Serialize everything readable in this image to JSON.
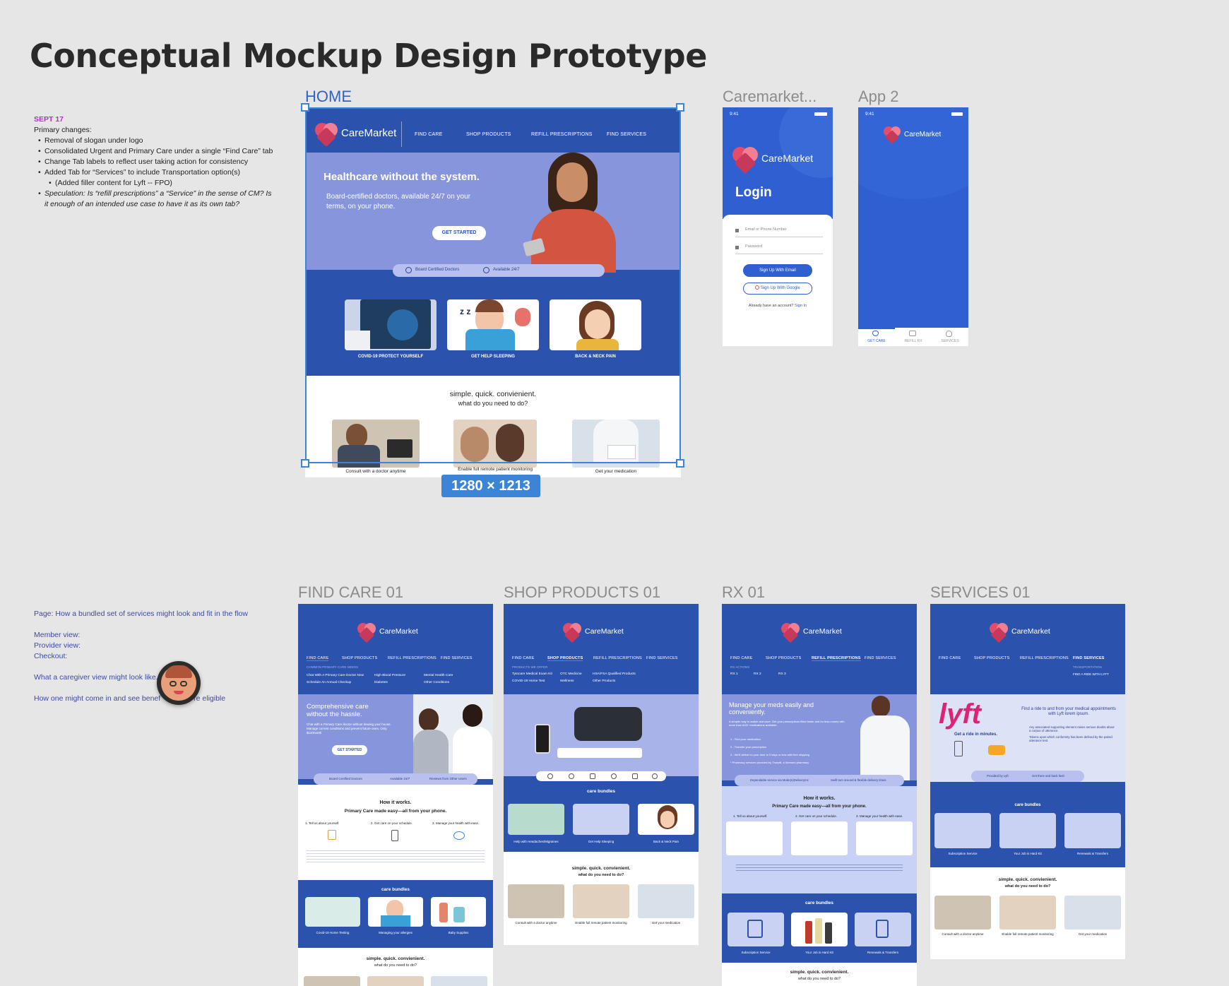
{
  "title": "Conceptual Mockup Design Prototype",
  "notes": {
    "date": "SEPT 17",
    "heading": "Primary changes:",
    "items": [
      "Removal of slogan under logo",
      "Consolidated Urgent and Primary Care under a single “Find Care” tab",
      "Change Tab labels to reflect user taking action for consistency",
      "Added Tab for “Services” to include Transportation option(s)",
      "(Added filler content for Lyft -- FPO)",
      "Speculation:  Is “refill prescriptions” a “Service” in the sense of CM?  Is it enough of an intended use case to have it as its own tab?"
    ]
  },
  "notes2": {
    "line1": "Page: How a bundled set of services might look and fit in the flow",
    "line2": "Member view:",
    "line3": "Provider view:",
    "line4": "Checkout:",
    "line5": "What a caregiver view might look like.",
    "line6": "How one might come in and see benef",
    "line6b": "hey're eligible"
  },
  "frames": {
    "home": "HOME",
    "caremarket": "Caremarket...",
    "app2": "App 2",
    "findcare": "FIND CARE 01",
    "shop": "SHOP PRODUCTS 01",
    "rx": "RX 01",
    "services": "SERVICES 01"
  },
  "dimensions": "1280 × 1213",
  "brand": {
    "name": "CareMarket",
    "primary": "#2b53ad",
    "hero": "#8796dc",
    "accent": "#e34d6a"
  },
  "nav": [
    "FIND CARE",
    "SHOP PRODUCTS",
    "REFILL PRESCRIPTIONS",
    "FIND SERVICES"
  ],
  "home": {
    "hero_title": "Healthcare without the system.",
    "hero_sub": "Board-certified doctors, available 24/7 on your terms, on your phone.",
    "cta": "GET STARTED",
    "badge1": "Board Certified Doctors",
    "badge2": "Available 24/7",
    "cards": [
      "COVID-19 PROTECT YOURSELF",
      "GET HELP SLEEPING",
      "BACK & NECK PAIN"
    ],
    "simple": "simple. quick. convienient.",
    "simple_sub": "what do you need to do?",
    "actions": [
      "Consult with a doctor anytime",
      "Enable full remote patient monitoring",
      "Get your medication"
    ]
  },
  "login": {
    "time": "9:41",
    "heading": "Login",
    "email_ph": "Email or Phone Number",
    "password_ph": "Password",
    "signup_email": "Sign Up With Email",
    "signup_google": "Sign Up With Google",
    "already": "Already have an account?",
    "signin": "Sign In"
  },
  "app2": {
    "time": "9:41",
    "tabs": [
      "GET CARE",
      "REFILL RX",
      "SERVICES"
    ]
  },
  "findcare": {
    "sub": "COMMON PRIMARY CARE NEEDS",
    "links": [
      "Chat With A Primary Care Doctor Now",
      "High Blood Pressure",
      "Mental Health Care",
      "Schedule An Annual Checkup",
      "Diabetes",
      "Other Conditions"
    ],
    "hero_title": "Comprehensive care without the hassle.",
    "hero_sub": "Chat with a Primary Care doctor without leaving your house. Manage current conditions and prevent future ones. Only $12/month",
    "cta": "GET STARTED",
    "badges": [
      "Board Certified Doctors",
      "Available 24/7",
      "Reviews from Other Users"
    ],
    "how": "How it works.",
    "how_sub": "Primary Care made easy—all from your phone.",
    "steps": [
      "1. Tell us about yourself.",
      "2. Get care on your schedule.",
      "3. Manage your health with ease."
    ],
    "bundles": "care bundles",
    "bundle_items": [
      "Covid-19 Home Testing",
      "Managing your allergies",
      "Baby Supplies"
    ],
    "simple": "simple. quick. convienient.",
    "simple_sub": "what do you need to do?"
  },
  "shop": {
    "sub": "PRODUCTS WE OFFER",
    "links": [
      "Tytocare Medical Exam Kit",
      "OTC Medicine",
      "HSA/FSA Qualified Products",
      "COVID-19 Home Test",
      "Wellness",
      "Other Products"
    ],
    "bundles": "care bundles",
    "bundle_items": [
      "Help with Headaches/Migraines",
      "Get Help Sleeping",
      "Back & Neck Pain"
    ],
    "simple": "simple. quick. convienient.",
    "simple_sub": "what do you need to do?",
    "actions": [
      "Consult with a doctor anytime",
      "Enable full remote patient monitoring",
      "Get your medication"
    ]
  },
  "rx": {
    "sub": "RX ACTIONS",
    "links": [
      "RX 1",
      "RX 2",
      "RX 3"
    ],
    "hero_title": "Manage your meds easily and conveniently.",
    "hero_sub": "A simpler way to switch and save. Get your prescriptions filled faster and for less money with more than 600+ medications available.",
    "list": [
      "1 - Find your medication",
      "2 - Transfer your prescription",
      "3 - We'll deliver to your door in 3 days or less with free shipping",
      "* Pharmacy services provided by Truepill, a licensed pharmacy"
    ],
    "badges": [
      "Dependable service via Mode(s)DeliveryInc",
      "Swift turn around & flexible delivery times"
    ],
    "how": "How it works.",
    "how_sub": "Primary Care made easy—all from your phone.",
    "steps": [
      "1. Tell us about yourself.",
      "2. Get care on your schedule.",
      "3. Manage your health with ease."
    ],
    "bundles": "care bundles",
    "bundle_items": [
      "Subscription Service",
      "Your Job is Hard Kit",
      "Renewals & Transfers"
    ],
    "simple": "simple. quick. convienient.",
    "simple_sub": "what do you need to do?"
  },
  "services": {
    "sub1": "TRANSPORTATION",
    "sub2": "FIND A RIDE WITH LYFT",
    "lyft": "lyft",
    "ride": "Get a ride in minutes.",
    "hero_title": "Find a ride to and from your medical appointments with Lyft lorem ipsum.",
    "bullets": [
      "Any associated supporting element raises serious doubts about a corpus of utterance.",
      "Tokens upon which conformity has been defined by the paired utterance test."
    ],
    "badges": [
      "Provided by Lyft",
      "Get there and back fast!"
    ],
    "bundles": "care bundles",
    "bundle_items": [
      "Subscription Service",
      "Your Job is Hard Kit",
      "Renewals & Transfers"
    ],
    "simple": "simple. quick. convienient.",
    "simple_sub": "what do you need to do?",
    "actions": [
      "Consult with a doctor anytime",
      "Enable full remote patient monitoring",
      "Get your medication"
    ]
  }
}
